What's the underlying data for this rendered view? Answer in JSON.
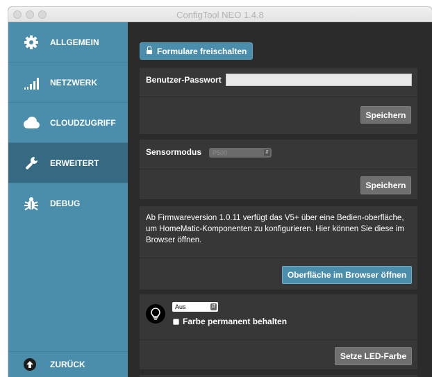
{
  "window": {
    "title": "ConfigTool NEO 1.4.8"
  },
  "sidebar": {
    "items": [
      {
        "label": "ALLGEMEIN",
        "icon": "gear-icon"
      },
      {
        "label": "NETZWERK",
        "icon": "signal-bars-icon"
      },
      {
        "label": "CLOUDZUGRIFF",
        "icon": "cloud-icon"
      },
      {
        "label": "ERWEITERT",
        "icon": "wrench-icon",
        "active": true
      },
      {
        "label": "DEBUG",
        "icon": "bug-icon"
      }
    ],
    "back": {
      "label": "ZURÜCK",
      "icon": "arrow-up-circle-icon"
    }
  },
  "main": {
    "unlock_button": {
      "label": "Formulare freischalten",
      "icon": "lock-icon"
    },
    "password_panel": {
      "label": "Benutzer-Passwort",
      "value": "",
      "save_label": "Speichern"
    },
    "sensor_panel": {
      "label": "Sensormodus",
      "select_value": "P500",
      "save_label": "Speichern"
    },
    "browser_panel": {
      "text": "Ab Firmwareversion 1.0.11 verfügt das V5+ über eine Bedien-oberfläche, um HomeMatic-Komponenten zu konfigurieren. Hier können Sie diese im Browser öffnen.",
      "button_label": "Oberfläche im Browser öffnen"
    },
    "led_panel": {
      "select_value": "Aus",
      "checkbox_label": "Farbe permanent behalten",
      "checkbox_checked": false,
      "button_label": "Setze LED-Farbe",
      "icon": "lightbulb-icon"
    }
  },
  "colors": {
    "sidebar_bg": "#4a8eac",
    "sidebar_active": "#356a82",
    "content_bg": "#2b2b2b",
    "panel_bg": "#373737",
    "accent_button": "#4a8eac",
    "gray_button": "#6f6f6f"
  }
}
